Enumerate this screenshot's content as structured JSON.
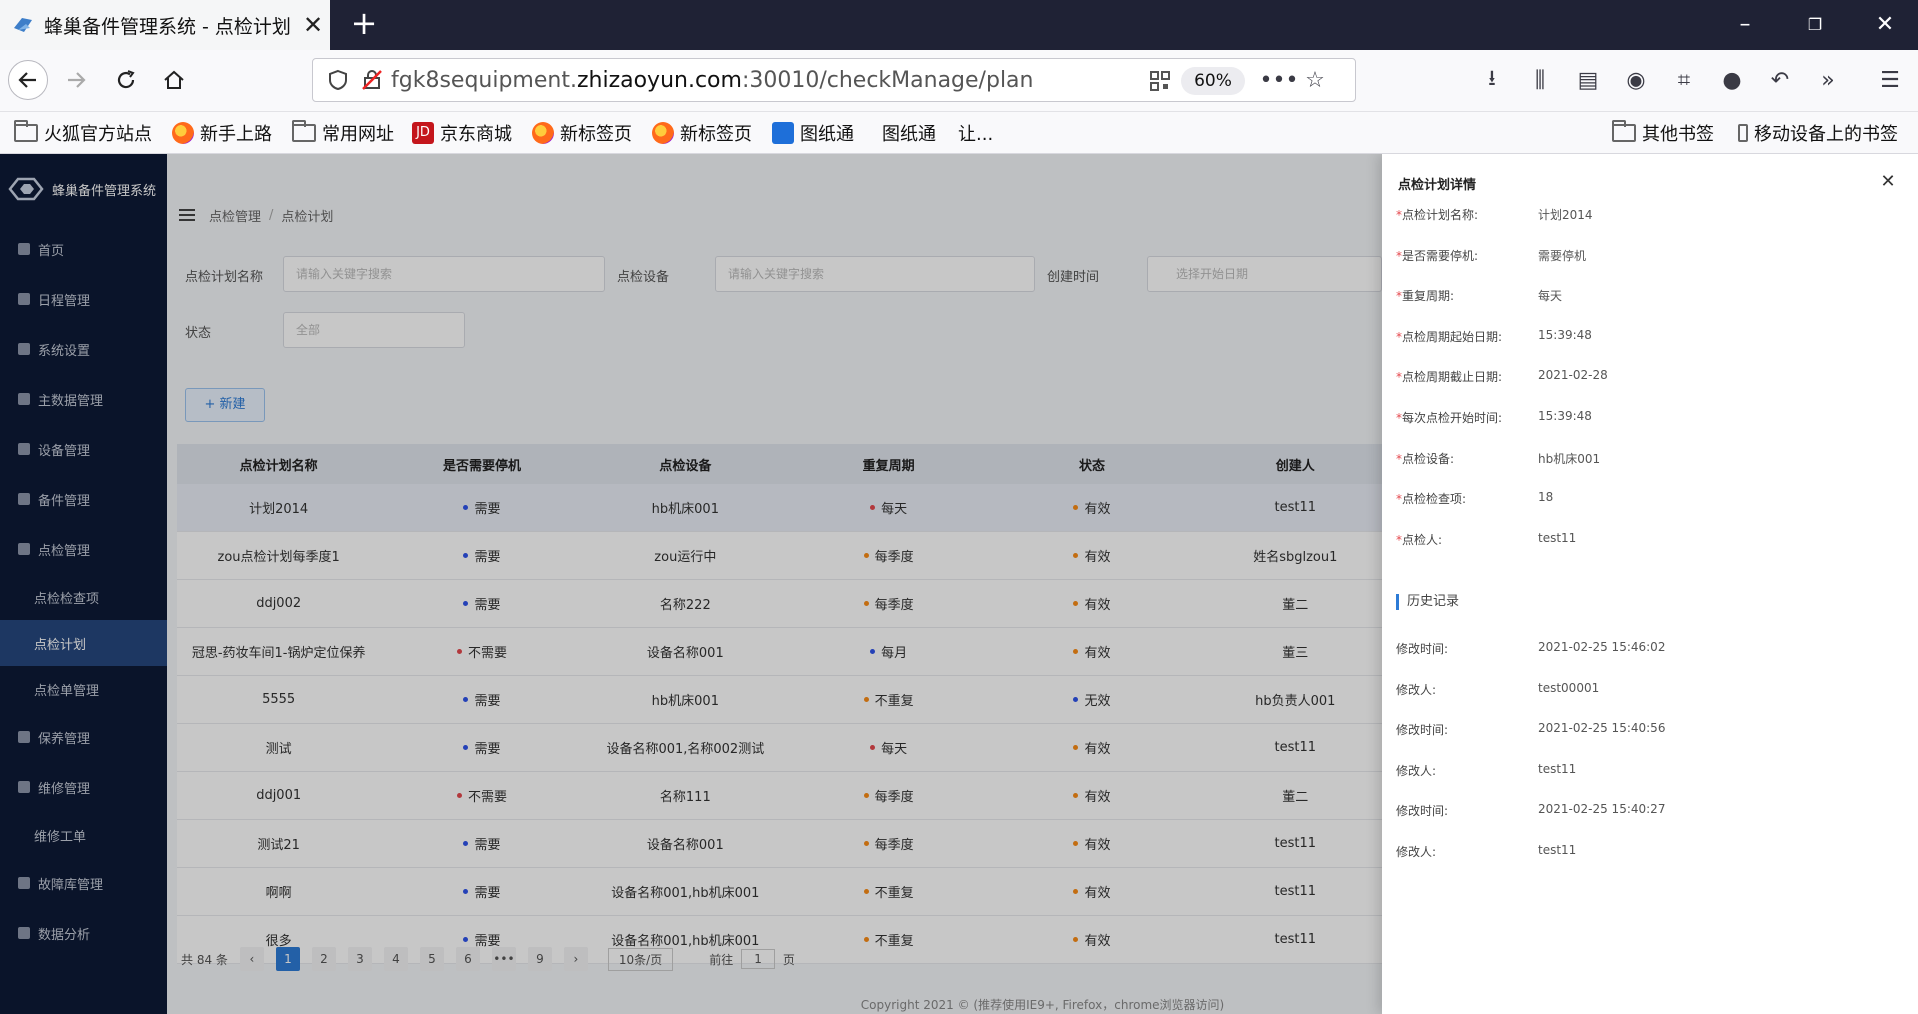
{
  "browser": {
    "tab_title": "蜂巢备件管理系统 - 点检计划",
    "url_prefix": "fgk8sequipment.",
    "url_domain": "zhizaoyun.com",
    "url_suffix": ":30010/checkManage/plan",
    "zoom": "60%",
    "bookmarks": [
      "火狐官方站点",
      "新手上路",
      "常用网址",
      "京东商城",
      "新标签页",
      "新标签页",
      "图纸通",
      "图纸通",
      "让...",
      "其他书签",
      "移动设备上的书签"
    ]
  },
  "app": {
    "name": "蜂巢备件管理系统",
    "menu": {
      "home": "首页",
      "schedule": "日程管理",
      "system": "系统设置",
      "master": "主数据管理",
      "device": "设备管理",
      "spare": "备件管理",
      "check": "点检管理",
      "check_items": "点检检查项",
      "check_plan": "点检计划",
      "check_orders": "点检单管理",
      "maintain": "保养管理",
      "repair": "维修管理",
      "repair_orders": "维修工单",
      "fault": "故障库管理",
      "analysis": "数据分析"
    },
    "breadcrumb": {
      "parent": "点检管理",
      "sep": "/",
      "current": "点检计划"
    },
    "filters": {
      "plan_name_label": "点检计划名称",
      "plan_name_placeholder": "请输入关键字搜索",
      "device_label": "点检设备",
      "device_placeholder": "请输入关键字搜索",
      "created_label": "创建时间",
      "created_placeholder": "选择开始日期",
      "status_label": "状态",
      "status_value": "全部"
    },
    "new_button": "+ 新建",
    "table": {
      "headers": [
        "点检计划名称",
        "是否需要停机",
        "点检设备",
        "重复周期",
        "状态",
        "创建人"
      ],
      "rows": [
        [
          "计划2014",
          "需要",
          "hb机床001",
          "每天",
          "有效",
          "test11"
        ],
        [
          "zou点检计划每季度1",
          "需要",
          "zou运行中",
          "每季度",
          "有效",
          "姓名sbglzou1"
        ],
        [
          "ddj002",
          "需要",
          "名称222",
          "每季度",
          "有效",
          "董二"
        ],
        [
          "冠思-药妆车间1-锅炉定位保养",
          "不需要",
          "设备名称001",
          "每月",
          "有效",
          "董三"
        ],
        [
          "5555",
          "需要",
          "hb机床001",
          "不重复",
          "无效",
          "hb负责人001"
        ],
        [
          "测试",
          "需要",
          "设备名称001,名称002测试",
          "每天",
          "有效",
          "test11"
        ],
        [
          "ddj001",
          "不需要",
          "名称111",
          "每季度",
          "有效",
          "董二"
        ],
        [
          "测试21",
          "需要",
          "设备名称001",
          "每季度",
          "有效",
          "test11"
        ],
        [
          "啊啊",
          "需要",
          "设备名称001,hb机床001",
          "不重复",
          "有效",
          "test11"
        ],
        [
          "很多",
          "需要",
          "设备名称001,hb机床001",
          "不重复",
          "有效",
          "test11"
        ]
      ]
    },
    "pager": {
      "total": "共 84 条",
      "pages": [
        "1",
        "2",
        "3",
        "4",
        "5",
        "6",
        "•••",
        "9"
      ],
      "size": "10条/页",
      "goto_prefix": "前往",
      "goto_value": "1",
      "goto_suffix": "页"
    },
    "copyright": "Copyright 2021 © (推荐使用IE9+, Firefox，chrome浏览器访问)"
  },
  "drawer": {
    "title": "点检计划详情",
    "fields": [
      {
        "label": "点检计划名称:",
        "value": "计划2014"
      },
      {
        "label": "是否需要停机:",
        "value": "需要停机"
      },
      {
        "label": "重复周期:",
        "value": "每天"
      },
      {
        "label": "点检周期起始日期:",
        "value": "15:39:48"
      },
      {
        "label": "点检周期截止日期:",
        "value": "2021-02-28"
      },
      {
        "label": "每次点检开始时间:",
        "value": "15:39:48"
      },
      {
        "label": "点检设备:",
        "value": "hb机床001"
      },
      {
        "label": "点检检查项:",
        "value": "18"
      },
      {
        "label": "点检人:",
        "value": "test11"
      }
    ],
    "history_title": "历史记录",
    "history": [
      {
        "label": "修改时间:",
        "value": "2021-02-25 15:46:02"
      },
      {
        "label": "修改人:",
        "value": "test00001"
      },
      {
        "label": "修改时间:",
        "value": "2021-02-25 15:40:56"
      },
      {
        "label": "修改人:",
        "value": "test11"
      },
      {
        "label": "修改时间:",
        "value": "2021-02-25 15:40:27"
      },
      {
        "label": "修改人:",
        "value": "test11"
      }
    ]
  },
  "colors": {
    "dot_blue": "#2f54eb",
    "dot_red": "#e5484d",
    "dot_orange": "#fa8c16",
    "accent": "#2d7bd6"
  }
}
